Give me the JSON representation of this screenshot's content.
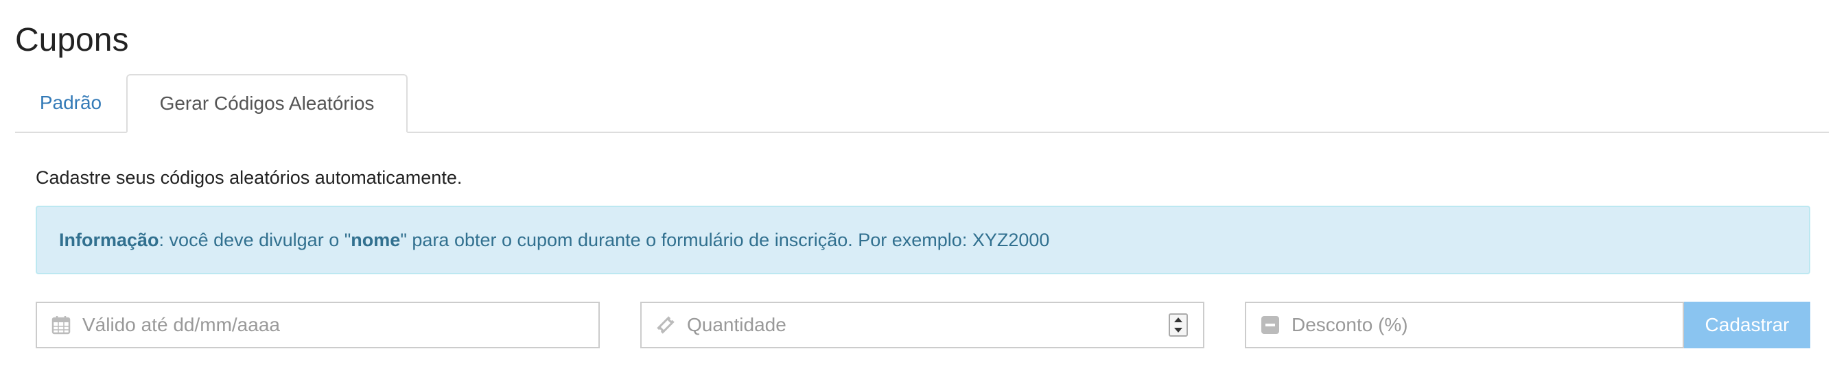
{
  "page": {
    "title": "Cupons"
  },
  "tabs": [
    {
      "label": "Padrão",
      "active": false
    },
    {
      "label": "Gerar Códigos Aleatórios",
      "active": true
    }
  ],
  "intro_text": "Cadastre seus códigos aleatórios automaticamente.",
  "alert": {
    "label": "Informação",
    "text_before": ": você deve divulgar o \"",
    "keyword": "nome",
    "text_after": "\" para obter o cupom durante o formulário de inscrição. Por exemplo: XYZ2000"
  },
  "form": {
    "valid_until": {
      "placeholder": "Válido até dd/mm/aaaa",
      "value": "",
      "icon": "calendar-icon"
    },
    "quantity": {
      "placeholder": "Quantidade",
      "value": "",
      "icon": "ticket-icon"
    },
    "discount": {
      "placeholder": "Desconto (%)",
      "value": "",
      "icon": "minus-square-icon"
    },
    "submit_label": "Cadastrar"
  },
  "colors": {
    "link": "#337ab7",
    "alert_bg": "#d9edf7",
    "alert_text": "#31708f",
    "button_bg": "#8ac4f0"
  }
}
